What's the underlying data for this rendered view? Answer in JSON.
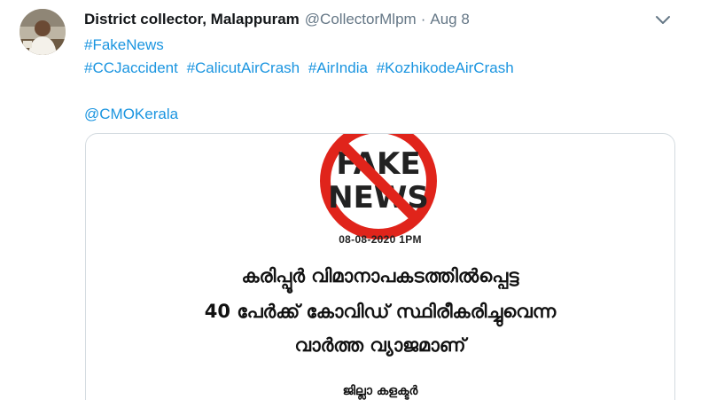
{
  "tweet": {
    "author_name": "District collector, Malappuram",
    "handle": "@CollectorMlpm",
    "separator": "·",
    "date": "Aug 8",
    "hashtags_line1": [
      "#FakeNews"
    ],
    "hashtags_line2": [
      "#CCJaccident",
      "#CalicutAirCrash",
      "#AirIndia",
      "#KozhikodeAirCrash"
    ],
    "mention": "@CMOKerala"
  },
  "image_card": {
    "stamp_word1": "FAKE",
    "stamp_word2": "NEWS",
    "timestamp": "08-08-2020 1PM",
    "line1": "കരിപ്പൂർ വിമാനാപകടത്തിൽപ്പെട്ട",
    "line2": "40 പേർക്ക് കോവിഡ് സ്ഥിരീകരിച്ചുവെന്ന",
    "line3": "വാർത്ത വ്യാജമാണ്",
    "signature": "ജില്ലാ കളക്ടർ"
  },
  "colors": {
    "link": "#1b95e0",
    "muted": "#657786",
    "stamp_red": "#e0241b"
  },
  "icons": {
    "caret": "chevron-down-icon",
    "avatar": "avatar"
  }
}
